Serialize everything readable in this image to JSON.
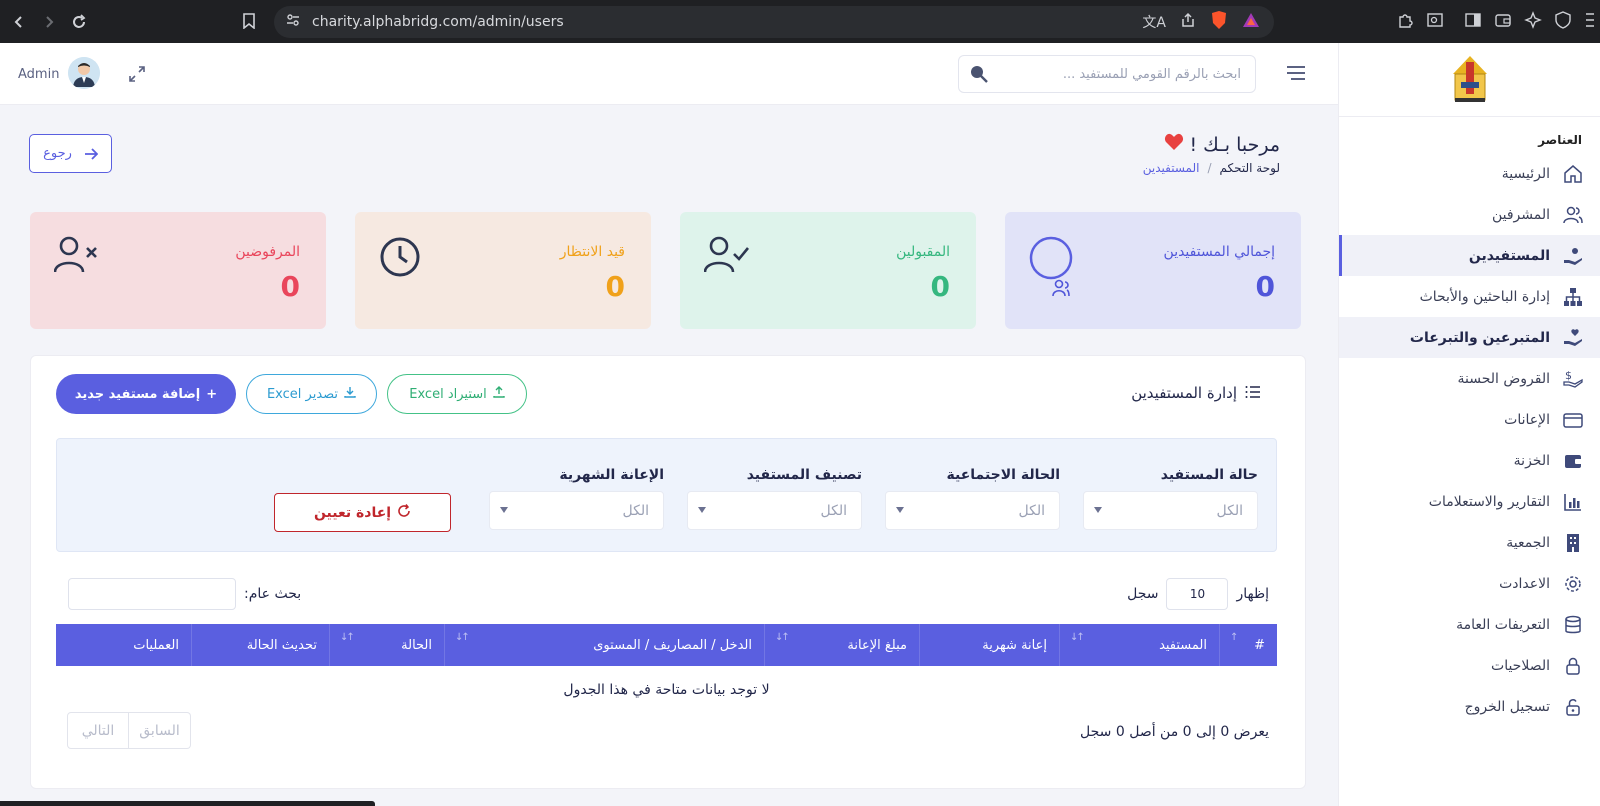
{
  "browser": {
    "url": "charity.alphabridg.com/admin/users"
  },
  "header": {
    "search_placeholder": "ابحث بالرقم القومي للمستفيد ...",
    "admin_label": "Admin"
  },
  "sidebar": {
    "section_title": "العناصر",
    "items": [
      {
        "label": "الرئيسية",
        "icon": "home-icon"
      },
      {
        "label": "المشرفين",
        "icon": "users-icon"
      },
      {
        "label": "المستفيدين",
        "icon": "hand-coin-icon",
        "active": true
      },
      {
        "label": "إدارة الباحثين والأبحاث",
        "icon": "sitemap-icon"
      },
      {
        "label": "المتبرعين والتبرعات",
        "icon": "hand-heart-icon"
      },
      {
        "label": "القروض الحسنة",
        "icon": "dollar-hand-icon"
      },
      {
        "label": "الإعانات",
        "icon": "card-icon"
      },
      {
        "label": "الخزنة",
        "icon": "wallet-icon"
      },
      {
        "label": "التقارير والاستعلامات",
        "icon": "chart-icon"
      },
      {
        "label": "الجمعية",
        "icon": "building-icon"
      },
      {
        "label": "الاعدادت",
        "icon": "gear-icon"
      },
      {
        "label": "التعريفات العامة",
        "icon": "database-icon"
      },
      {
        "label": "الصلاحيات",
        "icon": "lock-icon"
      },
      {
        "label": "تسجيل الخروج",
        "icon": "unlock-icon"
      }
    ]
  },
  "page": {
    "welcome": "مرحبا بـك !",
    "back_label": "رجوع",
    "breadcrumb": {
      "root": "لوحة التحكم",
      "sep": "/",
      "current": "المستفيدين"
    }
  },
  "stats": {
    "total": {
      "label": "إجمالي المستفيدين",
      "value": "0"
    },
    "accepted": {
      "label": "المقبولين",
      "value": "0"
    },
    "pending": {
      "label": "قيد الانتظار",
      "value": "0"
    },
    "rejected": {
      "label": "المرفوضين",
      "value": "0"
    }
  },
  "panel": {
    "title": "إدارة المستفيدين",
    "add_label": "إضافة مستفيد جديد",
    "export_label": "تصدير Excel",
    "import_label": "استيراد Excel"
  },
  "filters": {
    "status": {
      "label": "حالة المستفيد",
      "value": "الكل"
    },
    "social": {
      "label": "الحالة الاجتماعية",
      "value": "الكل"
    },
    "category": {
      "label": "تصنيف المستفيد",
      "value": "الكل"
    },
    "monthly": {
      "label": "الإعانة الشهرية",
      "value": "الكل"
    },
    "reset_label": "إعادة تعيين"
  },
  "table_controls": {
    "show_label": "إظهار",
    "show_value": "10",
    "records_label": "سجل",
    "search_label": "بحث عام:"
  },
  "table": {
    "columns": [
      "#",
      "المستفيد",
      "إعانة شهرية",
      "مبلغ الإعانة",
      "الدخل / المصاريف / المستوى",
      "الحالة",
      "تحديث الحالة",
      "العمليات"
    ],
    "empty": "لا توجد بيانات متاحة في هذا الجدول",
    "info": "يعرض 0 إلى 0 من أصل 0 سجل",
    "prev": "السابق",
    "next": "التالي"
  },
  "colors": {
    "accent": "#5a5fe0",
    "success": "#35b77f",
    "warning": "#f0a11a",
    "danger": "#e9455b"
  }
}
